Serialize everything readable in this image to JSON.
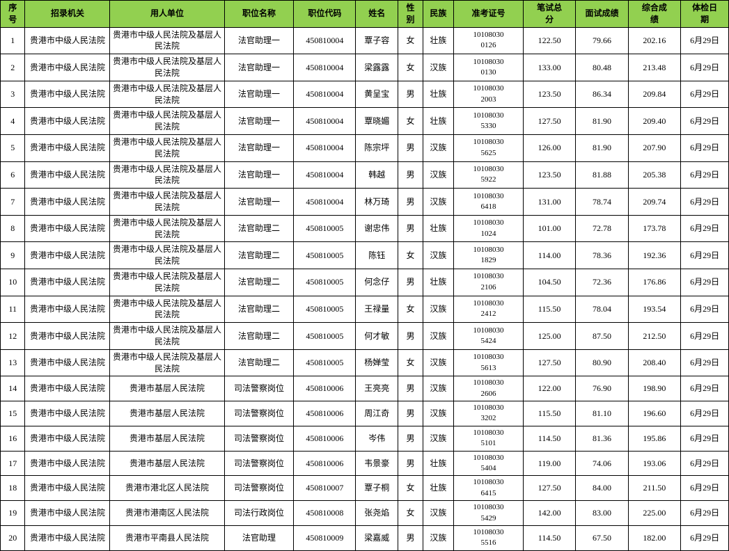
{
  "header": {
    "cols": [
      "序号",
      "招录机关",
      "用人单位",
      "职位名称",
      "职位代码",
      "姓名",
      "性别",
      "民族",
      "准考证号",
      "笔试总分",
      "面试成绩",
      "综合成绩",
      "体检日期"
    ]
  },
  "rows": [
    {
      "seq": "1",
      "recruit": "贵港市中级人民法院",
      "employer": "贵港市中级人民法院及基层人民法院",
      "position": "法官助理一",
      "code": "450810004",
      "name": "覃子容",
      "gender": "女",
      "ethnicity": "壮族",
      "examno": "10108030\n0126",
      "written": "122.50",
      "interview": "79.66",
      "composite": "202.16",
      "checkdate": "6月29日"
    },
    {
      "seq": "2",
      "recruit": "贵港市中级人民法院",
      "employer": "贵港市中级人民法院及基层人民法院",
      "position": "法官助理一",
      "code": "450810004",
      "name": "梁露露",
      "gender": "女",
      "ethnicity": "汉族",
      "examno": "10108030\n0130",
      "written": "133.00",
      "interview": "80.48",
      "composite": "213.48",
      "checkdate": "6月29日"
    },
    {
      "seq": "3",
      "recruit": "贵港市中级人民法院",
      "employer": "贵港市中级人民法院及基层人民法院",
      "position": "法官助理一",
      "code": "450810004",
      "name": "黄呈宝",
      "gender": "男",
      "ethnicity": "壮族",
      "examno": "10108030\n2003",
      "written": "123.50",
      "interview": "86.34",
      "composite": "209.84",
      "checkdate": "6月29日"
    },
    {
      "seq": "4",
      "recruit": "贵港市中级人民法院",
      "employer": "贵港市中级人民法院及基层人民法院",
      "position": "法官助理一",
      "code": "450810004",
      "name": "覃晓媚",
      "gender": "女",
      "ethnicity": "壮族",
      "examno": "10108030\n5330",
      "written": "127.50",
      "interview": "81.90",
      "composite": "209.40",
      "checkdate": "6月29日"
    },
    {
      "seq": "5",
      "recruit": "贵港市中级人民法院",
      "employer": "贵港市中级人民法院及基层人民法院",
      "position": "法官助理一",
      "code": "450810004",
      "name": "陈宗坪",
      "gender": "男",
      "ethnicity": "汉族",
      "examno": "10108030\n5625",
      "written": "126.00",
      "interview": "81.90",
      "composite": "207.90",
      "checkdate": "6月29日"
    },
    {
      "seq": "6",
      "recruit": "贵港市中级人民法院",
      "employer": "贵港市中级人民法院及基层人民法院",
      "position": "法官助理一",
      "code": "450810004",
      "name": "韩越",
      "gender": "男",
      "ethnicity": "汉族",
      "examno": "10108030\n5922",
      "written": "123.50",
      "interview": "81.88",
      "composite": "205.38",
      "checkdate": "6月29日"
    },
    {
      "seq": "7",
      "recruit": "贵港市中级人民法院",
      "employer": "贵港市中级人民法院及基层人民法院",
      "position": "法官助理一",
      "code": "450810004",
      "name": "林万琦",
      "gender": "男",
      "ethnicity": "汉族",
      "examno": "10108030\n6418",
      "written": "131.00",
      "interview": "78.74",
      "composite": "209.74",
      "checkdate": "6月29日"
    },
    {
      "seq": "8",
      "recruit": "贵港市中级人民法院",
      "employer": "贵港市中级人民法院及基层人民法院",
      "position": "法官助理二",
      "code": "450810005",
      "name": "谢忠伟",
      "gender": "男",
      "ethnicity": "壮族",
      "examno": "10108030\n1024",
      "written": "101.00",
      "interview": "72.78",
      "composite": "173.78",
      "checkdate": "6月29日"
    },
    {
      "seq": "9",
      "recruit": "贵港市中级人民法院",
      "employer": "贵港市中级人民法院及基层人民法院",
      "position": "法官助理二",
      "code": "450810005",
      "name": "陈钰",
      "gender": "女",
      "ethnicity": "汉族",
      "examno": "10108030\n1829",
      "written": "114.00",
      "interview": "78.36",
      "composite": "192.36",
      "checkdate": "6月29日"
    },
    {
      "seq": "10",
      "recruit": "贵港市中级人民法院",
      "employer": "贵港市中级人民法院及基层人民法院",
      "position": "法官助理二",
      "code": "450810005",
      "name": "何念仔",
      "gender": "男",
      "ethnicity": "壮族",
      "examno": "10108030\n2106",
      "written": "104.50",
      "interview": "72.36",
      "composite": "176.86",
      "checkdate": "6月29日"
    },
    {
      "seq": "11",
      "recruit": "贵港市中级人民法院",
      "employer": "贵港市中级人民法院及基层人民法院",
      "position": "法官助理二",
      "code": "450810005",
      "name": "王禄量",
      "gender": "女",
      "ethnicity": "汉族",
      "examno": "10108030\n2412",
      "written": "115.50",
      "interview": "78.04",
      "composite": "193.54",
      "checkdate": "6月29日"
    },
    {
      "seq": "12",
      "recruit": "贵港市中级人民法院",
      "employer": "贵港市中级人民法院及基层人民法院",
      "position": "法官助理二",
      "code": "450810005",
      "name": "何才敏",
      "gender": "男",
      "ethnicity": "汉族",
      "examno": "10108030\n5424",
      "written": "125.00",
      "interview": "87.50",
      "composite": "212.50",
      "checkdate": "6月29日"
    },
    {
      "seq": "13",
      "recruit": "贵港市中级人民法院",
      "employer": "贵港市中级人民法院及基层人民法院",
      "position": "法官助理二",
      "code": "450810005",
      "name": "杨婵莹",
      "gender": "女",
      "ethnicity": "汉族",
      "examno": "10108030\n5613",
      "written": "127.50",
      "interview": "80.90",
      "composite": "208.40",
      "checkdate": "6月29日"
    },
    {
      "seq": "14",
      "recruit": "贵港市中级人民法院",
      "employer": "贵港市基层人民法院",
      "position": "司法警察岗位",
      "code": "450810006",
      "name": "王亮亮",
      "gender": "男",
      "ethnicity": "汉族",
      "examno": "10108030\n2606",
      "written": "122.00",
      "interview": "76.90",
      "composite": "198.90",
      "checkdate": "6月29日"
    },
    {
      "seq": "15",
      "recruit": "贵港市中级人民法院",
      "employer": "贵港市基层人民法院",
      "position": "司法警察岗位",
      "code": "450810006",
      "name": "周江奇",
      "gender": "男",
      "ethnicity": "汉族",
      "examno": "10108030\n3202",
      "written": "115.50",
      "interview": "81.10",
      "composite": "196.60",
      "checkdate": "6月29日"
    },
    {
      "seq": "16",
      "recruit": "贵港市中级人民法院",
      "employer": "贵港市基层人民法院",
      "position": "司法警察岗位",
      "code": "450810006",
      "name": "岑伟",
      "gender": "男",
      "ethnicity": "汉族",
      "examno": "10108030\n5101",
      "written": "114.50",
      "interview": "81.36",
      "composite": "195.86",
      "checkdate": "6月29日"
    },
    {
      "seq": "17",
      "recruit": "贵港市中级人民法院",
      "employer": "贵港市基层人民法院",
      "position": "司法警察岗位",
      "code": "450810006",
      "name": "韦景豪",
      "gender": "男",
      "ethnicity": "壮族",
      "examno": "10108030\n5404",
      "written": "119.00",
      "interview": "74.06",
      "composite": "193.06",
      "checkdate": "6月29日"
    },
    {
      "seq": "18",
      "recruit": "贵港市中级人民法院",
      "employer": "贵港市港北区人民法院",
      "position": "司法警察岗位",
      "code": "450810007",
      "name": "覃子桐",
      "gender": "女",
      "ethnicity": "壮族",
      "examno": "10108030\n6415",
      "written": "127.50",
      "interview": "84.00",
      "composite": "211.50",
      "checkdate": "6月29日"
    },
    {
      "seq": "19",
      "recruit": "贵港市中级人民法院",
      "employer": "贵港市港南区人民法院",
      "position": "司法行政岗位",
      "code": "450810008",
      "name": "张尧焰",
      "gender": "女",
      "ethnicity": "汉族",
      "examno": "10108030\n5429",
      "written": "142.00",
      "interview": "83.00",
      "composite": "225.00",
      "checkdate": "6月29日"
    },
    {
      "seq": "20",
      "recruit": "贵港市中级人民法院",
      "employer": "贵港市平南县人民法院",
      "position": "法官助理",
      "code": "450810009",
      "name": "梁嘉威",
      "gender": "男",
      "ethnicity": "汉族",
      "examno": "10108030\n5516",
      "written": "114.50",
      "interview": "67.50",
      "composite": "182.00",
      "checkdate": "6月29日"
    }
  ]
}
